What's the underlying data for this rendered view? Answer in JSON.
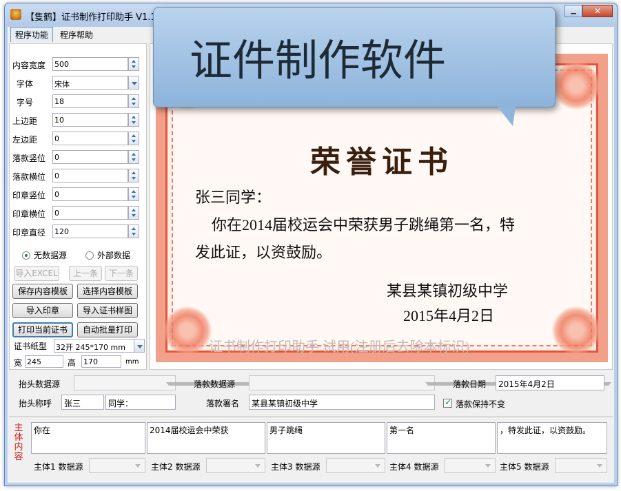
{
  "window": {
    "title": "【隻鹤】证书制作打印助手 V1.1",
    "min_label": "▁",
    "close_label": "✕"
  },
  "menu": [
    {
      "label": "程序功能"
    },
    {
      "label": "程序帮助"
    }
  ],
  "props": [
    {
      "label": "内容宽度",
      "value": "500",
      "control": "spin"
    },
    {
      "label": "字体",
      "value": "宋体",
      "control": "combo"
    },
    {
      "label": "字号",
      "value": "18",
      "control": "spin"
    },
    {
      "label": "上边距",
      "value": "10",
      "control": "spin"
    },
    {
      "label": "左边距",
      "value": "0",
      "control": "spin"
    },
    {
      "label": "落款竖位",
      "value": "0",
      "control": "spin"
    },
    {
      "label": "落款横位",
      "value": "0",
      "control": "spin"
    },
    {
      "label": "印章竖位",
      "value": "0",
      "control": "spin"
    },
    {
      "label": "印章横位",
      "value": "0",
      "control": "spin"
    },
    {
      "label": "印章直径",
      "value": "120",
      "control": "spin"
    }
  ],
  "datasource": {
    "none_label": "无数据源",
    "external_label": "外部数据",
    "selected": "none"
  },
  "nav_buttons": {
    "import_excel": "导入EXCEL",
    "prev": "上一条",
    "next": "下一条"
  },
  "actions": {
    "save_template": "保存内容模板",
    "select_template": "选择内容模板",
    "import_seal": "导入印章",
    "import_sample": "导入证书样图",
    "print_current": "打印当前证书",
    "auto_batch": "自动批量打印"
  },
  "paper": {
    "label": "证书纸型",
    "value": "32开  245*170 mm",
    "width_label": "宽",
    "width_value": "245",
    "height_label": "高",
    "height_value": "170",
    "unit": "mm"
  },
  "tooltip": {
    "text": "证件制作软件"
  },
  "certificate": {
    "title": "荣誉证书",
    "recipient": "张三同学：",
    "body_line1": "你在2014届校运会中荣获男子跳绳第一名，特",
    "body_line2": "发此证，以资鼓励。",
    "issuer": "某县某镇初级中学",
    "date": "2015年4月2日",
    "watermark": "证书制作打印助手   试用(注册后去除本标识)"
  },
  "fields": {
    "header_source_label": "抬头数据源",
    "header_source_value": "",
    "sign_source_label": "落款数据源",
    "sign_source_value": "",
    "sign_date_label": "落款日期",
    "sign_date_value": "2015年4月2日",
    "header_name_label": "抬头称呼",
    "header_name_value": "张三",
    "header_suffix_value": "同学：",
    "sign_name_label": "落款署名",
    "sign_name_value": "某县某镇初级中学",
    "keep_sign_label": "落款保持不变",
    "keep_sign_checked": true
  },
  "main_body": {
    "label": "主体内容",
    "parts": [
      {
        "text": "你在",
        "source_label": "主体1 数据源"
      },
      {
        "text": "2014届校运会中荣获",
        "source_label": "主体2 数据源"
      },
      {
        "text": "男子跳绳",
        "source_label": "主体3 数据源"
      },
      {
        "text": "第一名",
        "source_label": "主体4 数据源"
      },
      {
        "text": "，特发此证，以资鼓励。",
        "source_label": "主体5 数据源"
      }
    ]
  }
}
